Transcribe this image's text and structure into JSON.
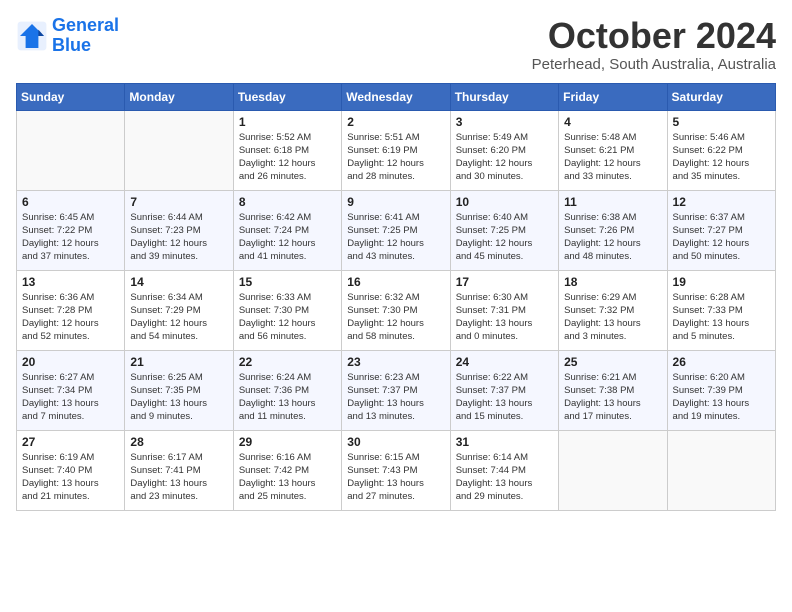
{
  "logo": {
    "line1": "General",
    "line2": "Blue"
  },
  "title": "October 2024",
  "subtitle": "Peterhead, South Australia, Australia",
  "days_of_week": [
    "Sunday",
    "Monday",
    "Tuesday",
    "Wednesday",
    "Thursday",
    "Friday",
    "Saturday"
  ],
  "weeks": [
    [
      {
        "day": "",
        "info": ""
      },
      {
        "day": "",
        "info": ""
      },
      {
        "day": "1",
        "info": "Sunrise: 5:52 AM\nSunset: 6:18 PM\nDaylight: 12 hours\nand 26 minutes."
      },
      {
        "day": "2",
        "info": "Sunrise: 5:51 AM\nSunset: 6:19 PM\nDaylight: 12 hours\nand 28 minutes."
      },
      {
        "day": "3",
        "info": "Sunrise: 5:49 AM\nSunset: 6:20 PM\nDaylight: 12 hours\nand 30 minutes."
      },
      {
        "day": "4",
        "info": "Sunrise: 5:48 AM\nSunset: 6:21 PM\nDaylight: 12 hours\nand 33 minutes."
      },
      {
        "day": "5",
        "info": "Sunrise: 5:46 AM\nSunset: 6:22 PM\nDaylight: 12 hours\nand 35 minutes."
      }
    ],
    [
      {
        "day": "6",
        "info": "Sunrise: 6:45 AM\nSunset: 7:22 PM\nDaylight: 12 hours\nand 37 minutes."
      },
      {
        "day": "7",
        "info": "Sunrise: 6:44 AM\nSunset: 7:23 PM\nDaylight: 12 hours\nand 39 minutes."
      },
      {
        "day": "8",
        "info": "Sunrise: 6:42 AM\nSunset: 7:24 PM\nDaylight: 12 hours\nand 41 minutes."
      },
      {
        "day": "9",
        "info": "Sunrise: 6:41 AM\nSunset: 7:25 PM\nDaylight: 12 hours\nand 43 minutes."
      },
      {
        "day": "10",
        "info": "Sunrise: 6:40 AM\nSunset: 7:25 PM\nDaylight: 12 hours\nand 45 minutes."
      },
      {
        "day": "11",
        "info": "Sunrise: 6:38 AM\nSunset: 7:26 PM\nDaylight: 12 hours\nand 48 minutes."
      },
      {
        "day": "12",
        "info": "Sunrise: 6:37 AM\nSunset: 7:27 PM\nDaylight: 12 hours\nand 50 minutes."
      }
    ],
    [
      {
        "day": "13",
        "info": "Sunrise: 6:36 AM\nSunset: 7:28 PM\nDaylight: 12 hours\nand 52 minutes."
      },
      {
        "day": "14",
        "info": "Sunrise: 6:34 AM\nSunset: 7:29 PM\nDaylight: 12 hours\nand 54 minutes."
      },
      {
        "day": "15",
        "info": "Sunrise: 6:33 AM\nSunset: 7:30 PM\nDaylight: 12 hours\nand 56 minutes."
      },
      {
        "day": "16",
        "info": "Sunrise: 6:32 AM\nSunset: 7:30 PM\nDaylight: 12 hours\nand 58 minutes."
      },
      {
        "day": "17",
        "info": "Sunrise: 6:30 AM\nSunset: 7:31 PM\nDaylight: 13 hours\nand 0 minutes."
      },
      {
        "day": "18",
        "info": "Sunrise: 6:29 AM\nSunset: 7:32 PM\nDaylight: 13 hours\nand 3 minutes."
      },
      {
        "day": "19",
        "info": "Sunrise: 6:28 AM\nSunset: 7:33 PM\nDaylight: 13 hours\nand 5 minutes."
      }
    ],
    [
      {
        "day": "20",
        "info": "Sunrise: 6:27 AM\nSunset: 7:34 PM\nDaylight: 13 hours\nand 7 minutes."
      },
      {
        "day": "21",
        "info": "Sunrise: 6:25 AM\nSunset: 7:35 PM\nDaylight: 13 hours\nand 9 minutes."
      },
      {
        "day": "22",
        "info": "Sunrise: 6:24 AM\nSunset: 7:36 PM\nDaylight: 13 hours\nand 11 minutes."
      },
      {
        "day": "23",
        "info": "Sunrise: 6:23 AM\nSunset: 7:37 PM\nDaylight: 13 hours\nand 13 minutes."
      },
      {
        "day": "24",
        "info": "Sunrise: 6:22 AM\nSunset: 7:37 PM\nDaylight: 13 hours\nand 15 minutes."
      },
      {
        "day": "25",
        "info": "Sunrise: 6:21 AM\nSunset: 7:38 PM\nDaylight: 13 hours\nand 17 minutes."
      },
      {
        "day": "26",
        "info": "Sunrise: 6:20 AM\nSunset: 7:39 PM\nDaylight: 13 hours\nand 19 minutes."
      }
    ],
    [
      {
        "day": "27",
        "info": "Sunrise: 6:19 AM\nSunset: 7:40 PM\nDaylight: 13 hours\nand 21 minutes."
      },
      {
        "day": "28",
        "info": "Sunrise: 6:17 AM\nSunset: 7:41 PM\nDaylight: 13 hours\nand 23 minutes."
      },
      {
        "day": "29",
        "info": "Sunrise: 6:16 AM\nSunset: 7:42 PM\nDaylight: 13 hours\nand 25 minutes."
      },
      {
        "day": "30",
        "info": "Sunrise: 6:15 AM\nSunset: 7:43 PM\nDaylight: 13 hours\nand 27 minutes."
      },
      {
        "day": "31",
        "info": "Sunrise: 6:14 AM\nSunset: 7:44 PM\nDaylight: 13 hours\nand 29 minutes."
      },
      {
        "day": "",
        "info": ""
      },
      {
        "day": "",
        "info": ""
      }
    ]
  ]
}
